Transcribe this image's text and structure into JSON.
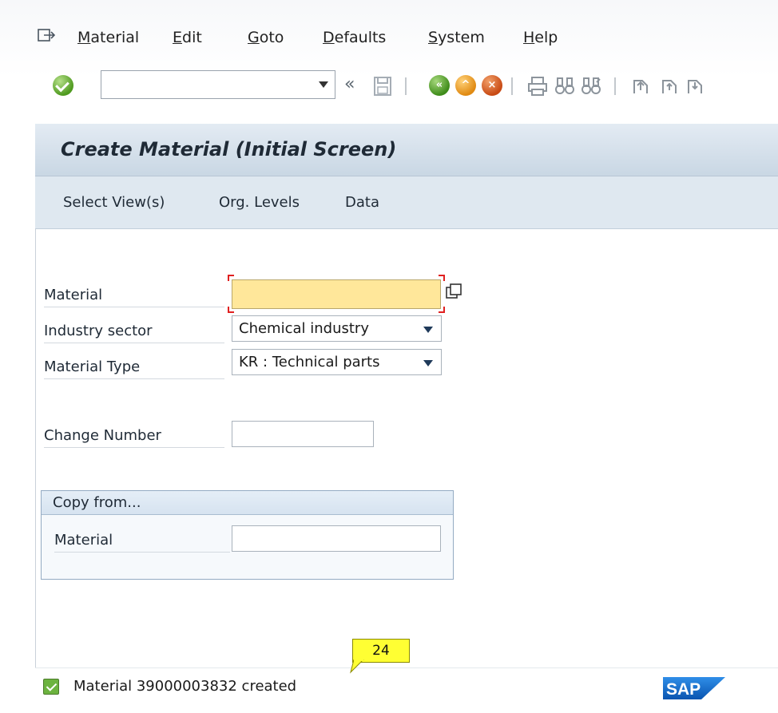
{
  "menubar": {
    "items": [
      {
        "first": "M",
        "rest": "aterial"
      },
      {
        "first": "E",
        "rest": "dit"
      },
      {
        "first": "G",
        "rest": "oto"
      },
      {
        "first": "D",
        "rest": "efaults"
      },
      {
        "first": "S",
        "rest": "ystem"
      },
      {
        "first": "H",
        "rest": "elp"
      }
    ]
  },
  "toolbar": {
    "command_value": "",
    "back_glyph": "«"
  },
  "screen": {
    "title": "Create Material (Initial Screen)",
    "app_buttons": [
      "Select View(s)",
      "Org. Levels",
      "Data"
    ]
  },
  "form": {
    "material_label": "Material",
    "material_value": "",
    "industry_label": "Industry sector",
    "industry_value": "Chemical industry",
    "type_label": "Material Type",
    "type_value": "KR : Technical parts",
    "change_label": "Change Number",
    "change_value": ""
  },
  "copy_from": {
    "title": "Copy from...",
    "material_label": "Material",
    "material_value": ""
  },
  "status": {
    "message": "Material 39000003832 created",
    "callout": "24",
    "logo": "SAP"
  },
  "colors": {
    "accent_field": "#ffe79a",
    "title_bar": "#c9d7e4",
    "success": "#6cb33f",
    "callout": "#ffff33"
  }
}
